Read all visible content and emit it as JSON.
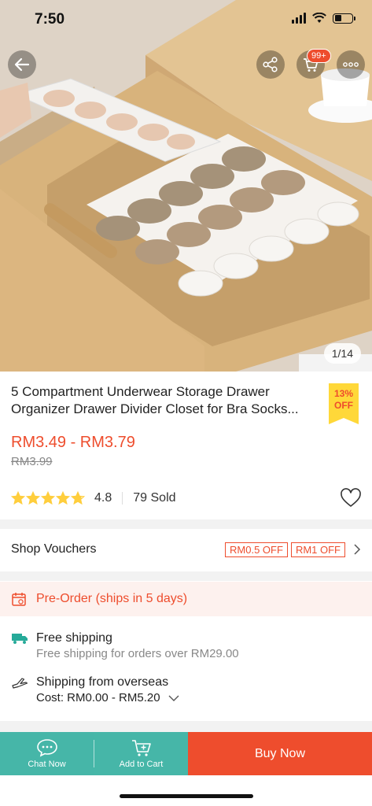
{
  "status_bar": {
    "time": "7:50"
  },
  "gallery": {
    "counter": "1/14",
    "cart_badge": "99+"
  },
  "product": {
    "title": "5 Compartment Underwear Storage Drawer Organizer Drawer Divider Closet for Bra Socks...",
    "discount_pct": "13%",
    "discount_label": "OFF",
    "price_range": "RM3.49 - RM3.79",
    "original_price": "RM3.99",
    "rating": "4.8",
    "rating_stars": 4.8,
    "sold": "79 Sold"
  },
  "vouchers": {
    "label": "Shop Vouchers",
    "chips": [
      "RM0.5 OFF",
      "RM1 OFF"
    ]
  },
  "preorder": {
    "text": "Pre-Order (ships in 5 days)"
  },
  "shipping": {
    "free_title": "Free shipping",
    "free_desc": "Free shipping for orders over RM29.00",
    "from_prefix": "Shipping from",
    "from_location": "overseas",
    "cost_label": "Cost: RM0.00 - RM5.20"
  },
  "bottom_bar": {
    "chat_label": "Chat Now",
    "add_cart_label": "Add to Cart",
    "buy_label": "Buy Now"
  },
  "colors": {
    "accent": "#ee4d2d",
    "teal": "#26aa99",
    "star": "#ffce3d",
    "badge": "#ffd839"
  },
  "icons": [
    "back-arrow-icon",
    "share-icon",
    "cart-icon",
    "more-icon",
    "heart-icon",
    "chevron-right-icon",
    "calendar-icon",
    "truck-icon",
    "plane-icon",
    "chevron-down-icon",
    "chat-icon",
    "add-to-cart-icon"
  ]
}
